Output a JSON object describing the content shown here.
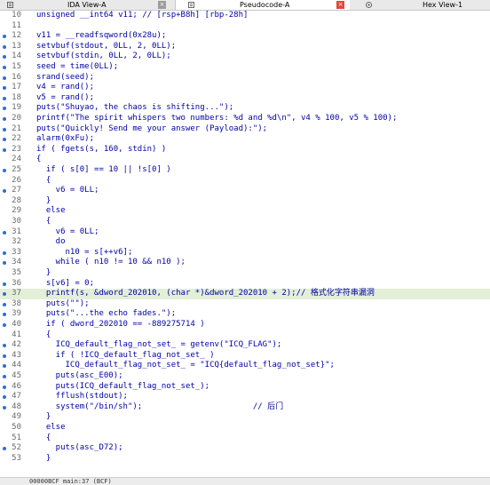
{
  "tabs": [
    {
      "label": "IDA View-A",
      "close": "×",
      "active": false
    },
    {
      "label": "Pseudocode-A",
      "close": "×",
      "active": true
    },
    {
      "label": "Hex View-1",
      "active": false
    }
  ],
  "lines": [
    {
      "n": "10",
      "dot": false,
      "t": "unsigned __int64 v11; // [rsp+B8h] [rbp-28h]"
    },
    {
      "n": "11",
      "dot": false,
      "t": ""
    },
    {
      "n": "12",
      "dot": true,
      "t": "v11 = __readfsqword(0x28u);"
    },
    {
      "n": "13",
      "dot": true,
      "t": "setvbuf(stdout, 0LL, 2, 0LL);"
    },
    {
      "n": "14",
      "dot": true,
      "t": "setvbuf(stdin, 0LL, 2, 0LL);"
    },
    {
      "n": "15",
      "dot": true,
      "t": "seed = time(0LL);"
    },
    {
      "n": "16",
      "dot": true,
      "t": "srand(seed);"
    },
    {
      "n": "17",
      "dot": true,
      "t": "v4 = rand();"
    },
    {
      "n": "18",
      "dot": true,
      "t": "v5 = rand();"
    },
    {
      "n": "19",
      "dot": true,
      "t": "puts(\"Shuyao, the chaos is shifting...\");"
    },
    {
      "n": "20",
      "dot": true,
      "t": "printf(\"The spirit whispers two numbers: %d and %d\\n\", v4 % 100, v5 % 100);"
    },
    {
      "n": "21",
      "dot": true,
      "t": "puts(\"Quickly! Send me your answer (Payload):\");"
    },
    {
      "n": "22",
      "dot": true,
      "t": "alarm(0xFu);"
    },
    {
      "n": "23",
      "dot": true,
      "t": "if ( fgets(s, 160, stdin) )"
    },
    {
      "n": "24",
      "dot": false,
      "t": "{"
    },
    {
      "n": "25",
      "dot": true,
      "t": "  if ( s[0] == 10 || !s[0] )"
    },
    {
      "n": "26",
      "dot": false,
      "t": "  {"
    },
    {
      "n": "27",
      "dot": true,
      "t": "    v6 = 0LL;"
    },
    {
      "n": "28",
      "dot": false,
      "t": "  }"
    },
    {
      "n": "29",
      "dot": false,
      "t": "  else"
    },
    {
      "n": "30",
      "dot": false,
      "t": "  {"
    },
    {
      "n": "31",
      "dot": true,
      "t": "    v6 = 0LL;"
    },
    {
      "n": "32",
      "dot": false,
      "t": "    do"
    },
    {
      "n": "33",
      "dot": true,
      "t": "      n10 = s[++v6];"
    },
    {
      "n": "34",
      "dot": true,
      "t": "    while ( n10 != 10 && n10 );"
    },
    {
      "n": "35",
      "dot": false,
      "t": "  }"
    },
    {
      "n": "36",
      "dot": true,
      "t": "  s[v6] = 0;"
    },
    {
      "n": "37",
      "dot": true,
      "t": "  printf(s, &dword_202010, (char *)&dword_202010 + 2);// 格式化字符串漏洞",
      "hl": true
    },
    {
      "n": "38",
      "dot": true,
      "t": "  puts(\"\");"
    },
    {
      "n": "39",
      "dot": true,
      "t": "  puts(\"...the echo fades.\");"
    },
    {
      "n": "40",
      "dot": true,
      "t": "  if ( dword_202010 == -889275714 )"
    },
    {
      "n": "41",
      "dot": false,
      "t": "  {"
    },
    {
      "n": "42",
      "dot": true,
      "t": "    ICQ_default_flag_not_set_ = getenv(\"ICQ_FLAG\");"
    },
    {
      "n": "43",
      "dot": true,
      "t": "    if ( !ICQ_default_flag_not_set_ )"
    },
    {
      "n": "44",
      "dot": true,
      "t": "      ICQ_default_flag_not_set_ = \"ICQ{default_flag_not_set}\";"
    },
    {
      "n": "45",
      "dot": true,
      "t": "    puts(asc_E00);"
    },
    {
      "n": "46",
      "dot": true,
      "t": "    puts(ICQ_default_flag_not_set_);"
    },
    {
      "n": "47",
      "dot": true,
      "t": "    fflush(stdout);"
    },
    {
      "n": "48",
      "dot": true,
      "t": "    system(\"/bin/sh\");                       // 后门"
    },
    {
      "n": "49",
      "dot": false,
      "t": "  }"
    },
    {
      "n": "50",
      "dot": false,
      "t": "  else"
    },
    {
      "n": "51",
      "dot": false,
      "t": "  {"
    },
    {
      "n": "52",
      "dot": true,
      "t": "    puts(asc_D72);"
    },
    {
      "n": "53",
      "dot": false,
      "t": "  }"
    }
  ],
  "status": "00000BCF main:37 (BCF)"
}
